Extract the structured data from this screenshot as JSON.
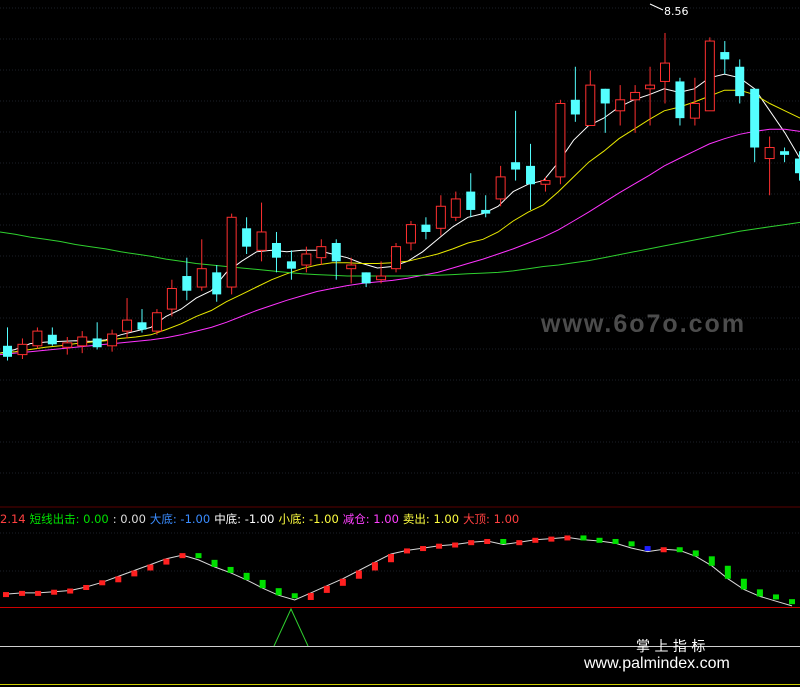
{
  "price_panel": {
    "high_label": "8.56",
    "watermark": "www.6o7o.com"
  },
  "indicator_panel": {
    "items": [
      {
        "text": "2.14",
        "color": "#ff4040"
      },
      {
        "text": "短线出击: 0.00",
        "color": "#00e000"
      },
      {
        "text": ": 0.00",
        "color": "#dddddd"
      },
      {
        "text": "大底: -1.00",
        "color": "#3a8cff"
      },
      {
        "text": "中底: -1.00",
        "color": "#ffffff"
      },
      {
        "text": "小底: -1.00",
        "color": "#ffff40"
      },
      {
        "text": "减仓: 1.00",
        "color": "#ff40ff"
      },
      {
        "text": "卖出: 1.00",
        "color": "#ffff40"
      },
      {
        "text": "大顶: 1.00",
        "color": "#ff4040"
      }
    ]
  },
  "branding": {
    "title": "掌 上 指 标",
    "url": "www.palmindex.com"
  },
  "colors": {
    "up_candle": "#ff3030",
    "down_candle": "#54ffff",
    "ma_white": "#ffffff",
    "ma_yellow": "#e8e800",
    "ma_magenta": "#ff33ff",
    "ma_green": "#2fd02f",
    "indicator_rise": "#ff2020",
    "indicator_fall": "#00e000",
    "indicator_mixed": "#2020ff",
    "zero_line": "#cc0000"
  },
  "chart_data": [
    {
      "type": "candlestick",
      "title": "",
      "y_range": [
        2.2,
        8.9
      ],
      "grid": true,
      "candles": [
        {
          "o": 4.3,
          "h": 4.55,
          "l": 4.1,
          "c": 4.15
        },
        {
          "o": 4.18,
          "h": 4.4,
          "l": 4.12,
          "c": 4.32
        },
        {
          "o": 4.3,
          "h": 4.55,
          "l": 4.26,
          "c": 4.5
        },
        {
          "o": 4.45,
          "h": 4.55,
          "l": 4.3,
          "c": 4.32
        },
        {
          "o": 4.28,
          "h": 4.42,
          "l": 4.18,
          "c": 4.34
        },
        {
          "o": 4.3,
          "h": 4.5,
          "l": 4.2,
          "c": 4.42
        },
        {
          "o": 4.4,
          "h": 4.62,
          "l": 4.25,
          "c": 4.28
        },
        {
          "o": 4.3,
          "h": 4.52,
          "l": 4.22,
          "c": 4.46
        },
        {
          "o": 4.5,
          "h": 4.95,
          "l": 4.4,
          "c": 4.65
        },
        {
          "o": 4.62,
          "h": 4.8,
          "l": 4.48,
          "c": 4.52
        },
        {
          "o": 4.5,
          "h": 4.8,
          "l": 4.45,
          "c": 4.75
        },
        {
          "o": 4.8,
          "h": 5.2,
          "l": 4.7,
          "c": 5.08
        },
        {
          "o": 5.25,
          "h": 5.5,
          "l": 4.92,
          "c": 5.05
        },
        {
          "o": 5.1,
          "h": 5.75,
          "l": 5.05,
          "c": 5.35
        },
        {
          "o": 5.3,
          "h": 5.4,
          "l": 4.9,
          "c": 5.0
        },
        {
          "o": 5.1,
          "h": 6.1,
          "l": 5.0,
          "c": 6.05
        },
        {
          "o": 5.9,
          "h": 6.05,
          "l": 5.55,
          "c": 5.65
        },
        {
          "o": 5.6,
          "h": 6.25,
          "l": 5.45,
          "c": 5.85
        },
        {
          "o": 5.7,
          "h": 5.85,
          "l": 5.3,
          "c": 5.5
        },
        {
          "o": 5.45,
          "h": 5.6,
          "l": 5.2,
          "c": 5.35
        },
        {
          "o": 5.4,
          "h": 5.65,
          "l": 5.3,
          "c": 5.55
        },
        {
          "o": 5.5,
          "h": 5.75,
          "l": 5.4,
          "c": 5.65
        },
        {
          "o": 5.7,
          "h": 5.75,
          "l": 5.2,
          "c": 5.45
        },
        {
          "o": 5.35,
          "h": 5.5,
          "l": 5.15,
          "c": 5.4
        },
        {
          "o": 5.3,
          "h": 5.3,
          "l": 5.1,
          "c": 5.15
        },
        {
          "o": 5.2,
          "h": 5.45,
          "l": 5.15,
          "c": 5.25
        },
        {
          "o": 5.35,
          "h": 5.7,
          "l": 5.3,
          "c": 5.65
        },
        {
          "o": 5.7,
          "h": 6.0,
          "l": 5.6,
          "c": 5.95
        },
        {
          "o": 5.95,
          "h": 6.05,
          "l": 5.75,
          "c": 5.85
        },
        {
          "o": 5.9,
          "h": 6.35,
          "l": 5.8,
          "c": 6.2
        },
        {
          "o": 6.05,
          "h": 6.4,
          "l": 6.0,
          "c": 6.3
        },
        {
          "o": 6.4,
          "h": 6.65,
          "l": 6.05,
          "c": 6.15
        },
        {
          "o": 6.15,
          "h": 6.35,
          "l": 6.05,
          "c": 6.1
        },
        {
          "o": 6.3,
          "h": 6.75,
          "l": 6.2,
          "c": 6.6
        },
        {
          "o": 6.8,
          "h": 7.5,
          "l": 6.55,
          "c": 6.7
        },
        {
          "o": 6.75,
          "h": 7.05,
          "l": 6.15,
          "c": 6.5
        },
        {
          "o": 6.5,
          "h": 6.6,
          "l": 6.4,
          "c": 6.55
        },
        {
          "o": 6.6,
          "h": 7.65,
          "l": 6.5,
          "c": 7.6
        },
        {
          "o": 7.65,
          "h": 8.1,
          "l": 7.35,
          "c": 7.45
        },
        {
          "o": 7.3,
          "h": 8.05,
          "l": 7.3,
          "c": 7.85
        },
        {
          "o": 7.8,
          "h": 7.8,
          "l": 7.2,
          "c": 7.6
        },
        {
          "o": 7.5,
          "h": 7.85,
          "l": 7.3,
          "c": 7.65
        },
        {
          "o": 7.65,
          "h": 7.85,
          "l": 7.2,
          "c": 7.75
        },
        {
          "o": 7.8,
          "h": 8.1,
          "l": 7.3,
          "c": 7.85
        },
        {
          "o": 7.9,
          "h": 8.56,
          "l": 7.6,
          "c": 8.15
        },
        {
          "o": 7.9,
          "h": 7.95,
          "l": 7.3,
          "c": 7.4
        },
        {
          "o": 7.4,
          "h": 7.95,
          "l": 7.3,
          "c": 7.6
        },
        {
          "o": 7.5,
          "h": 8.5,
          "l": 7.5,
          "c": 8.45
        },
        {
          "o": 8.3,
          "h": 8.45,
          "l": 8.0,
          "c": 8.2
        },
        {
          "o": 8.1,
          "h": 8.2,
          "l": 7.6,
          "c": 7.7
        },
        {
          "o": 7.8,
          "h": 7.8,
          "l": 6.8,
          "c": 7.0
        },
        {
          "o": 6.85,
          "h": 7.15,
          "l": 6.35,
          "c": 7.0
        },
        {
          "o": 6.95,
          "h": 7.0,
          "l": 6.8,
          "c": 6.9
        },
        {
          "o": 6.85,
          "h": 6.95,
          "l": 6.55,
          "c": 6.65
        }
      ],
      "series": [
        {
          "values": [
            4.2,
            4.25,
            4.33,
            4.35,
            4.36,
            4.37,
            4.36,
            4.38,
            4.45,
            4.5,
            4.55,
            4.7,
            4.8,
            4.95,
            5.05,
            5.3,
            5.45,
            5.58,
            5.6,
            5.58,
            5.6,
            5.6,
            5.55,
            5.5,
            5.42,
            5.36,
            5.38,
            5.45,
            5.58,
            5.75,
            5.92,
            6.05,
            6.1,
            6.2,
            6.4,
            6.5,
            6.55,
            6.8,
            7.1,
            7.3,
            7.4,
            7.55,
            7.65,
            7.72,
            7.8,
            7.75,
            7.8,
            7.95,
            8.0,
            7.95,
            7.8,
            7.5,
            7.2,
            6.85
          ]
        },
        {
          "values": [
            4.2,
            4.22,
            4.25,
            4.28,
            4.3,
            4.33,
            4.35,
            4.37,
            4.4,
            4.42,
            4.45,
            4.52,
            4.6,
            4.7,
            4.78,
            4.9,
            5.0,
            5.1,
            5.2,
            5.28,
            5.35,
            5.4,
            5.43,
            5.43,
            5.42,
            5.42,
            5.43,
            5.45,
            5.5,
            5.55,
            5.62,
            5.7,
            5.75,
            5.85,
            6.0,
            6.12,
            6.22,
            6.4,
            6.6,
            6.8,
            6.95,
            7.12,
            7.25,
            7.38,
            7.5,
            7.55,
            7.62,
            7.7,
            7.78,
            7.78,
            7.72,
            7.6,
            7.5,
            7.4
          ]
        },
        {
          "values": [
            4.18,
            4.2,
            4.22,
            4.24,
            4.26,
            4.28,
            4.3,
            4.32,
            4.34,
            4.36,
            4.38,
            4.41,
            4.45,
            4.5,
            4.55,
            4.62,
            4.7,
            4.78,
            4.85,
            4.92,
            4.98,
            5.04,
            5.08,
            5.12,
            5.15,
            5.17,
            5.19,
            5.22,
            5.26,
            5.3,
            5.36,
            5.42,
            5.48,
            5.55,
            5.62,
            5.7,
            5.78,
            5.88,
            6.0,
            6.12,
            6.25,
            6.38,
            6.5,
            6.62,
            6.75,
            6.85,
            6.95,
            7.05,
            7.12,
            7.18,
            7.22,
            7.25,
            7.25,
            7.22
          ]
        },
        {
          "values": [
            5.85,
            5.82,
            5.78,
            5.75,
            5.72,
            5.68,
            5.65,
            5.62,
            5.58,
            5.55,
            5.52,
            5.48,
            5.45,
            5.42,
            5.4,
            5.38,
            5.36,
            5.34,
            5.32,
            5.3,
            5.28,
            5.27,
            5.26,
            5.25,
            5.25,
            5.25,
            5.25,
            5.25,
            5.26,
            5.26,
            5.27,
            5.28,
            5.29,
            5.3,
            5.32,
            5.35,
            5.38,
            5.4,
            5.43,
            5.46,
            5.5,
            5.54,
            5.58,
            5.62,
            5.66,
            5.7,
            5.74,
            5.78,
            5.82,
            5.86,
            5.89,
            5.92,
            5.95,
            5.98
          ]
        }
      ]
    },
    {
      "type": "bar",
      "title": "",
      "values": [
        0.04,
        0.05,
        0.05,
        0.06,
        0.07,
        0.1,
        0.14,
        0.19,
        0.24,
        0.29,
        0.34,
        0.37,
        0.33,
        0.27,
        0.22,
        0.16,
        0.09,
        0.03,
        -0.01,
        0.05,
        0.11,
        0.17,
        0.24,
        0.31,
        0.38,
        0.41,
        0.43,
        0.45,
        0.46,
        0.48,
        0.49,
        0.46,
        0.48,
        0.5,
        0.51,
        0.52,
        0.5,
        0.49,
        0.47,
        0.43,
        0.4,
        0.42,
        0.41,
        0.36,
        0.28,
        0.17,
        0.08,
        0.02,
        -0.02,
        -0.06
      ],
      "states": [
        "up",
        "up",
        "up",
        "up",
        "up",
        "up",
        "up",
        "up",
        "up",
        "up",
        "up",
        "up",
        "down",
        "down",
        "down",
        "down",
        "down",
        "down",
        "down",
        "up",
        "up",
        "up",
        "up",
        "up",
        "up",
        "up",
        "up",
        "up",
        "up",
        "up",
        "up",
        "down",
        "up",
        "up",
        "up",
        "up",
        "down",
        "down",
        "down",
        "down",
        "mixed",
        "up",
        "down",
        "down",
        "down",
        "down",
        "down",
        "down",
        "down",
        "down"
      ],
      "signal_pulse_index": 17,
      "y_range": [
        -0.4,
        0.6
      ]
    }
  ]
}
